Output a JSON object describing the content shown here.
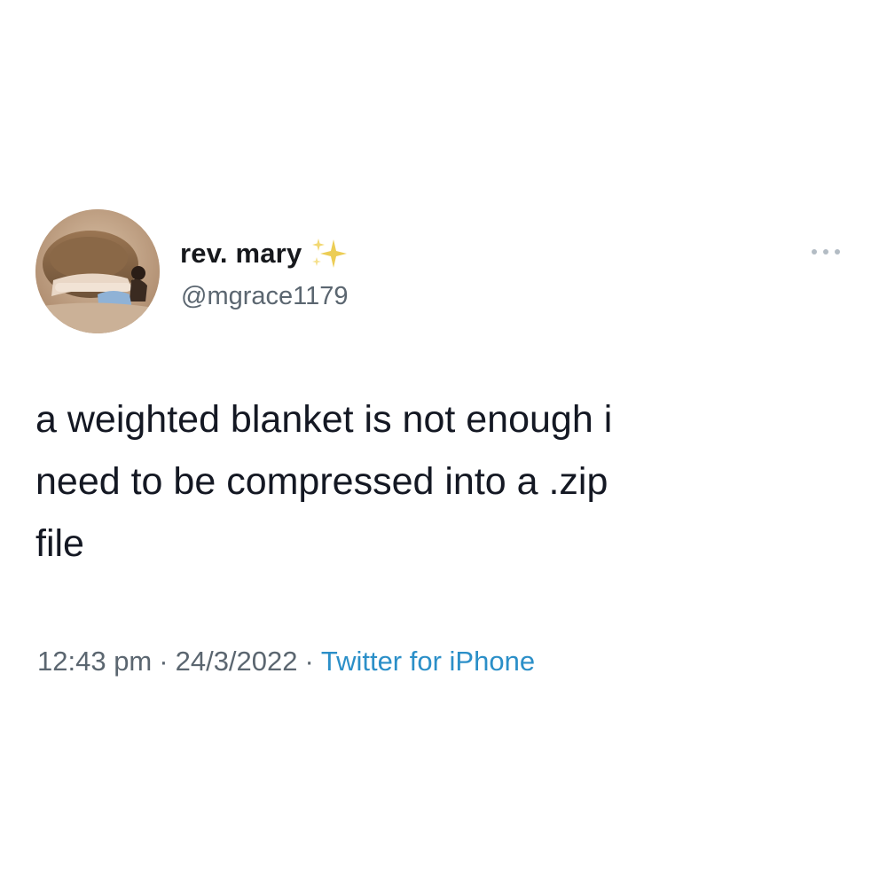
{
  "tweet": {
    "author": {
      "display_name": "rev. mary",
      "name_decoration_icon": "sparkles-icon",
      "handle": "@mgrace1179",
      "avatar_icon": "profile-photo"
    },
    "more_icon": "ellipsis-icon",
    "text": "a weighted blanket is not enough i\nneed to be compressed into a .zip\nfile",
    "time": "12:43 pm",
    "separator": "·",
    "date": "24/3/2022",
    "source": "Twitter for iPhone"
  },
  "colors": {
    "background": "#ffffff",
    "text": "#141823",
    "secondary_text": "#5b6670",
    "link": "#2b8fc8",
    "sparkles": "#e8c547"
  }
}
